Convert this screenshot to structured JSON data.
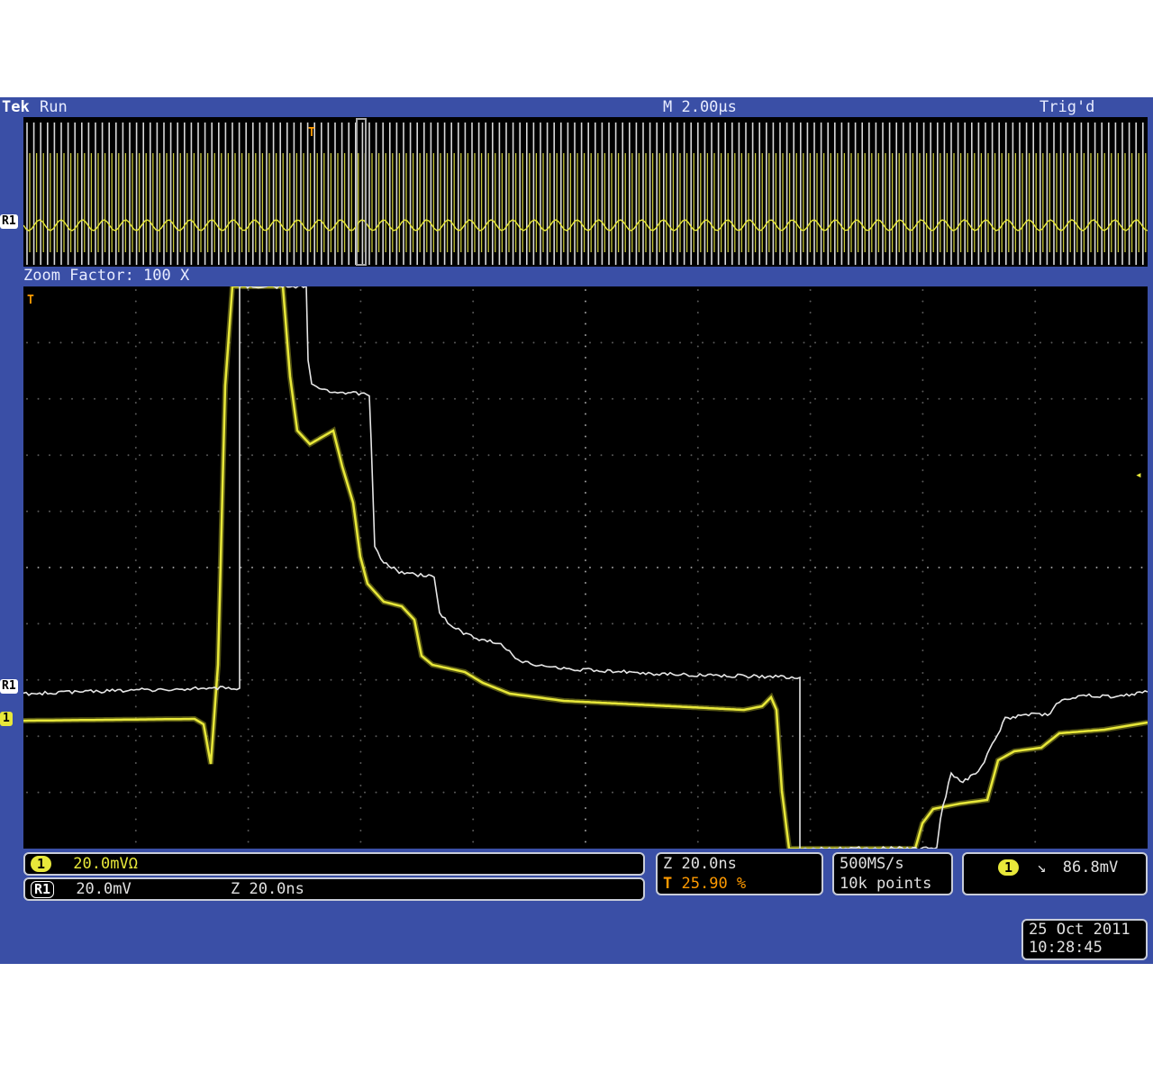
{
  "header": {
    "brand": "Tek",
    "state": "Run",
    "timebase": "M 2.00µs",
    "trigger_status": "Trig'd"
  },
  "zoom": {
    "label": "Zoom Factor: 100 X"
  },
  "markers": {
    "ref_label": "R1",
    "ch1_label": "1",
    "trigger_label": "T"
  },
  "readouts": {
    "ch1_scale": "20.0mVΩ",
    "r1_scale": "20.0mV",
    "r1_zoom": "Z 20.0ns",
    "zoom_time": "Z 20.0ns",
    "trigger_pos": "25.90 %",
    "sample_rate": "500MS/s",
    "record_length": "10k points",
    "trigger_slope": "↘",
    "trigger_level": "86.8mV"
  },
  "datetime": {
    "date": "25 Oct  2011",
    "time": "10:28:45"
  },
  "colors": {
    "screen_bg": "#3a4fa6",
    "ch1": "#e8e83a",
    "ref": "#e6e6e6",
    "trigger": "#ff9a00"
  }
}
